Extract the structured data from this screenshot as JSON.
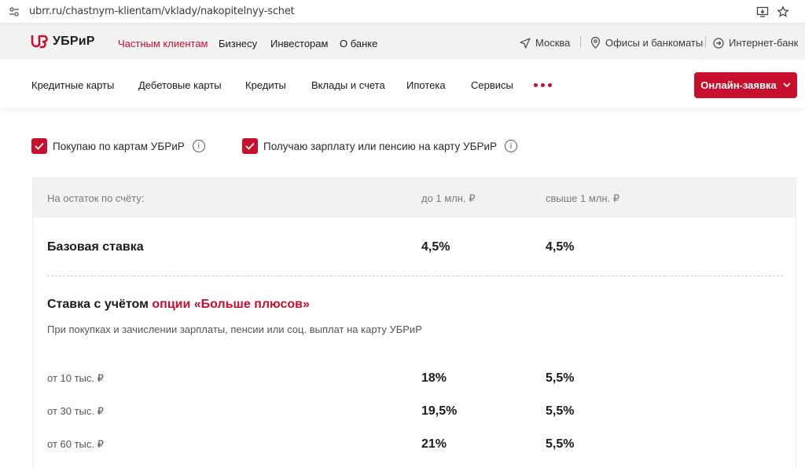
{
  "browser": {
    "url": "ubrr.ru/chastnym-klientam/vklady/nakopitelnyy-schet"
  },
  "header": {
    "logo": "УБРиР",
    "top_nav": [
      "Частным клиентам",
      "Бизнесу",
      "Инвесторам",
      "О банке"
    ],
    "city": "Москва",
    "offices": "Офисы и банкоматы",
    "internet_bank": "Интернет-банк"
  },
  "main_nav": {
    "items": [
      "Кредитные карты",
      "Дебетовые карты",
      "Кредиты",
      "Вклады и счета",
      "Ипотека",
      "Сервисы"
    ],
    "apply_button": "Онлайн-заявка"
  },
  "options": {
    "cards_purchase": "Покупаю по картам УБРиР",
    "salary": "Получаю зарплату или пенсию на карту УБРиР"
  },
  "table": {
    "headers": [
      "На остаток по счёту:",
      "до 1 млн. ₽",
      "свыше 1 млн. ₽"
    ],
    "base_label": "Базовая ставка",
    "base_rates": [
      "4,5%",
      "4,5%"
    ],
    "option_title_prefix": "Ставка с учётом ",
    "option_title_highlight": "опции «Больше плюсов»",
    "option_description": "При покупках и зачислении зарплаты, пенсии или соц. выплат на карту УБРиР",
    "tiers": [
      {
        "label": "от 10 тыс. ₽",
        "rate_low": "18%",
        "rate_high": "5,5%"
      },
      {
        "label": "от 30 тыс. ₽",
        "rate_low": "19,5%",
        "rate_high": "5,5%"
      },
      {
        "label": "от 60 тыс. ₽",
        "rate_low": "21%",
        "rate_high": "5,5%"
      }
    ]
  },
  "colors": {
    "brand_red": "#c8102e",
    "header_bg": "#f2f2f2"
  }
}
